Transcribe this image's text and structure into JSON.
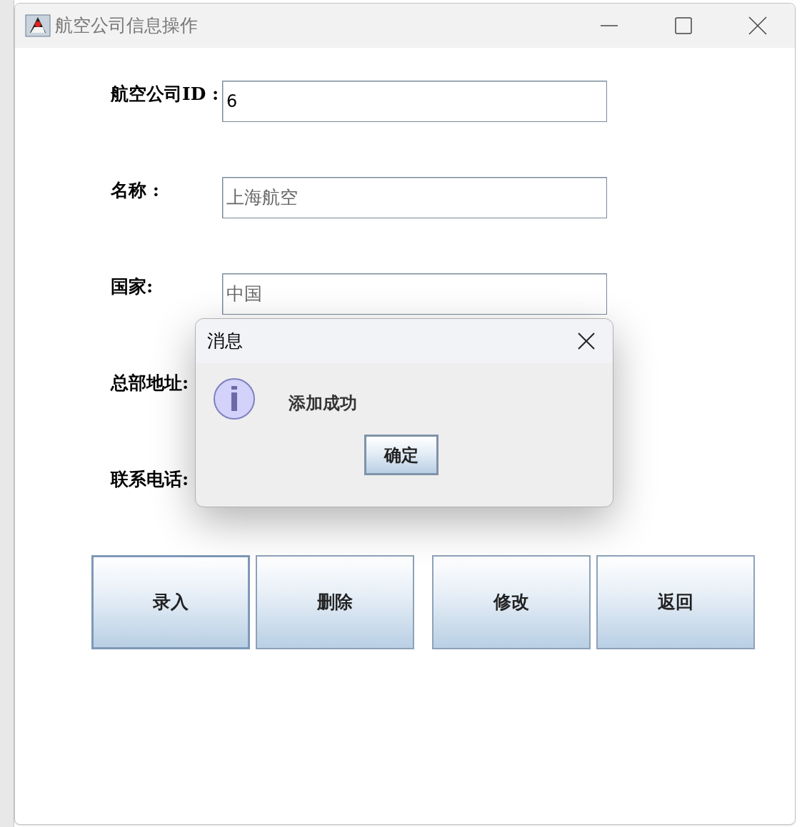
{
  "window": {
    "title": "航空公司信息操作"
  },
  "form": [
    {
      "label": "航空公司ID :",
      "value": "6",
      "disabled": false,
      "kind": "field"
    },
    {
      "label": "名称 :",
      "value": "上海航空",
      "disabled": true,
      "kind": "field"
    },
    {
      "label": "国家:",
      "value": "中国",
      "disabled": true,
      "kind": "field"
    },
    {
      "label": "总部地址:",
      "kind": "hidden"
    },
    {
      "label": "联系电话:",
      "kind": "hidden"
    }
  ],
  "buttons": [
    {
      "label": "录入",
      "focused": true
    },
    {
      "label": "删除",
      "focused": false
    },
    {
      "label": "修改",
      "focused": false
    },
    {
      "label": "返回",
      "focused": false
    }
  ],
  "dialog": {
    "title": "消息",
    "message": "添加成功",
    "button": "确定"
  }
}
